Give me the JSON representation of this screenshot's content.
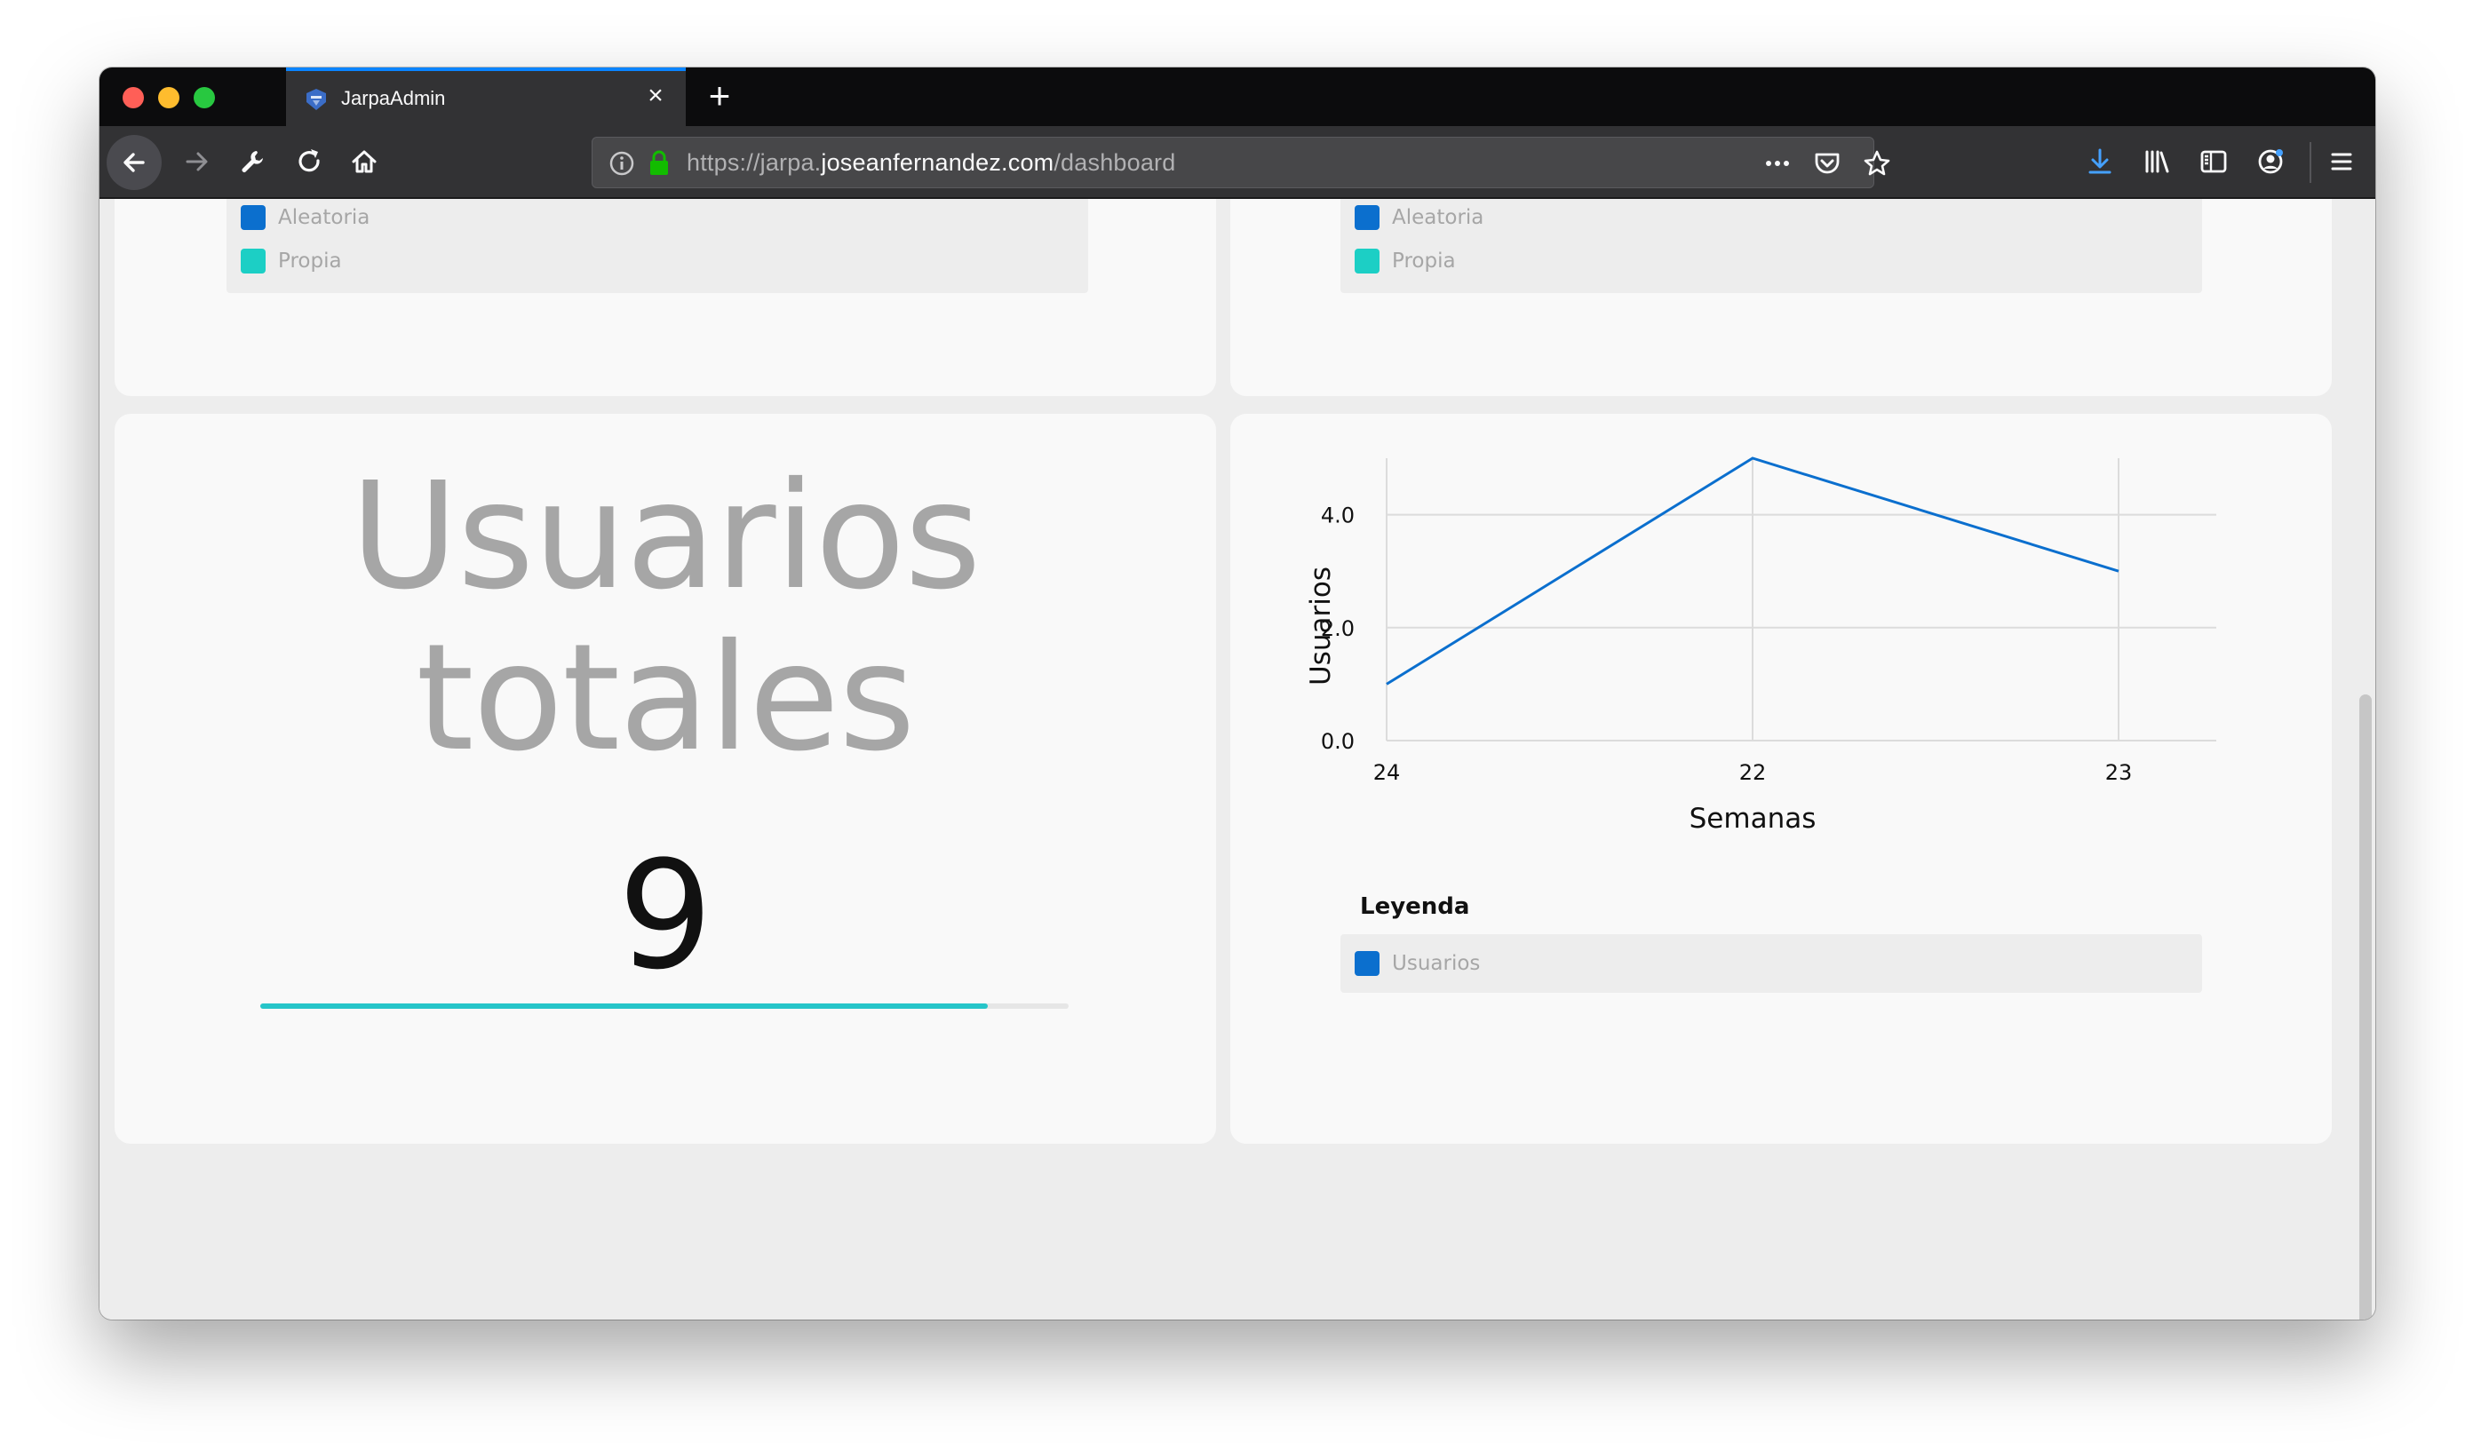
{
  "browser": {
    "tab_title": "JarpaAdmin",
    "url_scheme": "https://jarpa.",
    "url_host": "joseanfernandez.com",
    "url_path": "/dashboard",
    "accent_color": "#0a84ff"
  },
  "top_cards": [
    {
      "legend": [
        {
          "label": "Aleatoria",
          "color": "#0b6fce"
        },
        {
          "label": "Propia",
          "color": "#1ccfc5"
        }
      ]
    },
    {
      "legend": [
        {
          "label": "Aleatoria",
          "color": "#0b6fce"
        },
        {
          "label": "Propia",
          "color": "#1ccfc5"
        }
      ]
    }
  ],
  "users_card": {
    "title_line1": "Usuarios",
    "title_line2": "totales",
    "value": "9",
    "progress_fraction": 0.9,
    "progress_color": "#26c5c9"
  },
  "chart_card": {
    "legend_title": "Leyenda",
    "legend": [
      {
        "label": "Usuarios",
        "color": "#0b6fce"
      }
    ]
  },
  "chart_data": {
    "type": "line",
    "categories": [
      "24",
      "22",
      "23"
    ],
    "series": [
      {
        "name": "Usuarios",
        "values": [
          1.0,
          5.0,
          3.0
        ],
        "color": "#0b6fce"
      }
    ],
    "xlabel": "Semanas",
    "ylabel": "Usuarios",
    "yticks": [
      "0.0",
      "2.0",
      "4.0"
    ],
    "ylim": [
      0,
      5
    ],
    "grid": true
  }
}
